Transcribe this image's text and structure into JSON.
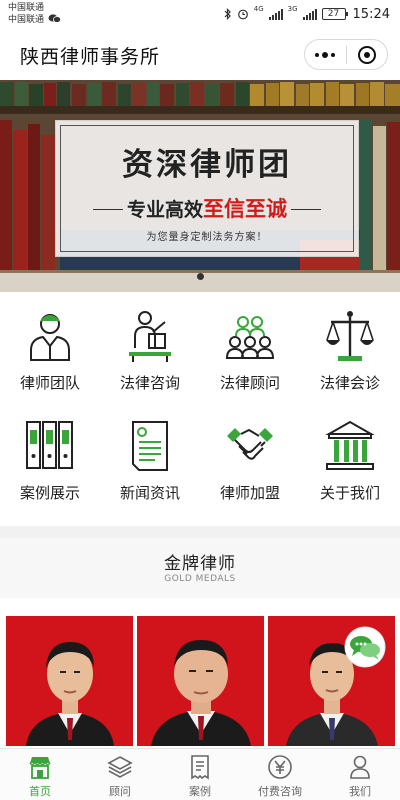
{
  "status_bar": {
    "carrier_1": "中国联通",
    "carrier_2": "中国联通",
    "network_1": "4G",
    "network_2": "3G",
    "battery": "27",
    "time": "15:24"
  },
  "title_bar": {
    "title": "陕西律师事务所"
  },
  "banner": {
    "headline": "资深律师团",
    "slogan_prefix": "专业高效",
    "slogan_highlight": "至信至诚",
    "subline": "为您量身定制法务方案！"
  },
  "menu": [
    {
      "label": "律师团队",
      "icon": "lawyer-team-icon"
    },
    {
      "label": "法律咨询",
      "icon": "legal-consult-icon"
    },
    {
      "label": "法律顾问",
      "icon": "legal-advisor-icon"
    },
    {
      "label": "法律会诊",
      "icon": "scales-icon"
    },
    {
      "label": "案例展示",
      "icon": "case-binders-icon"
    },
    {
      "label": "新闻资讯",
      "icon": "news-icon"
    },
    {
      "label": "律师加盟",
      "icon": "handshake-icon"
    },
    {
      "label": "关于我们",
      "icon": "building-icon"
    }
  ],
  "section": {
    "title": "金牌律师",
    "subtitle": "GOLD MEDALS"
  },
  "tabbar": [
    {
      "label": "首页",
      "icon": "home-icon",
      "active": true
    },
    {
      "label": "顾问",
      "icon": "layers-icon",
      "active": false
    },
    {
      "label": "案例",
      "icon": "receipt-icon",
      "active": false
    },
    {
      "label": "付费咨询",
      "icon": "yuan-icon",
      "active": false
    },
    {
      "label": "我们",
      "icon": "person-icon",
      "active": false
    }
  ],
  "colors": {
    "accent_green": "#3aa53a",
    "banner_red": "#d11a1a",
    "card_red": "#d1141b"
  }
}
